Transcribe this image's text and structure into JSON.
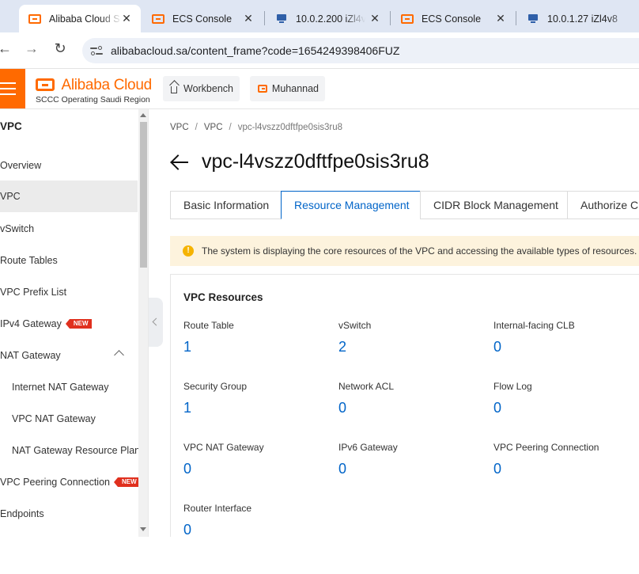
{
  "browser": {
    "tabs": [
      {
        "title": "Alibaba Cloud S",
        "icon": "alibaba-cloud-icon",
        "active": true
      },
      {
        "title": "ECS Console",
        "icon": "alibaba-cloud-icon",
        "active": false
      },
      {
        "title": "10.0.2.200 iZl4v",
        "icon": "remote-desktop-icon",
        "active": false
      },
      {
        "title": "ECS Console",
        "icon": "alibaba-cloud-icon",
        "active": false
      },
      {
        "title": "10.0.1.27 iZl4v8",
        "icon": "remote-desktop-icon",
        "active": false
      }
    ],
    "close_glyph": "✕",
    "url": "alibabacloud.sa/content_frame?code=1654249398406FUZ"
  },
  "console": {
    "logo_text": "Alibaba Cloud",
    "logo_subtitle": "SCCC Operating Saudi Region",
    "workbench_label": "Workbench",
    "account_label": "Muhannad",
    "brand_color": "#ff6a00"
  },
  "sidebar": {
    "title": "VPC",
    "items": [
      {
        "label": "Overview"
      },
      {
        "label": "VPC",
        "selected": true
      },
      {
        "label": "vSwitch"
      },
      {
        "label": "Route Tables"
      },
      {
        "label": "VPC Prefix List"
      },
      {
        "label": "IPv4 Gateway",
        "badge": "NEW"
      },
      {
        "label": "NAT Gateway",
        "expanded": true
      },
      {
        "label": "Internet NAT Gateway",
        "sub": true
      },
      {
        "label": "VPC NAT Gateway",
        "sub": true
      },
      {
        "label": "NAT Gateway Resource Plan",
        "sub": true
      },
      {
        "label": "VPC Peering Connection",
        "badge": "NEW"
      },
      {
        "label": "Endpoints"
      }
    ]
  },
  "main": {
    "breadcrumb": [
      "VPC",
      "VPC",
      "vpc-l4vszz0dftfpe0sis3ru8"
    ],
    "breadcrumb_sep": "/",
    "title": "vpc-l4vszz0dftfpe0sis3ru8",
    "tabs": [
      {
        "label": "Basic Information",
        "active": false
      },
      {
        "label": "Resource Management",
        "active": true
      },
      {
        "label": "CIDR Block Management",
        "active": false
      },
      {
        "label": "Authorize Cr",
        "active": false
      }
    ],
    "notice": {
      "icon": "!",
      "text": "The system is displaying the core resources of the VPC and accessing the available types of resources."
    },
    "resources": {
      "title": "VPC Resources",
      "items": [
        {
          "label": "Route Table",
          "value": "1"
        },
        {
          "label": "vSwitch",
          "value": "2"
        },
        {
          "label": "Internal-facing CLB",
          "value": "0"
        },
        {
          "label": "Security Group",
          "value": "1"
        },
        {
          "label": "Network ACL",
          "value": "0"
        },
        {
          "label": "Flow Log",
          "value": "0"
        },
        {
          "label": "VPC NAT Gateway",
          "value": "0"
        },
        {
          "label": "IPv6 Gateway",
          "value": "0"
        },
        {
          "label": "VPC Peering Connection",
          "value": "0"
        },
        {
          "label": "Router Interface",
          "value": "0"
        }
      ]
    },
    "accent_color": "#0064c8"
  }
}
